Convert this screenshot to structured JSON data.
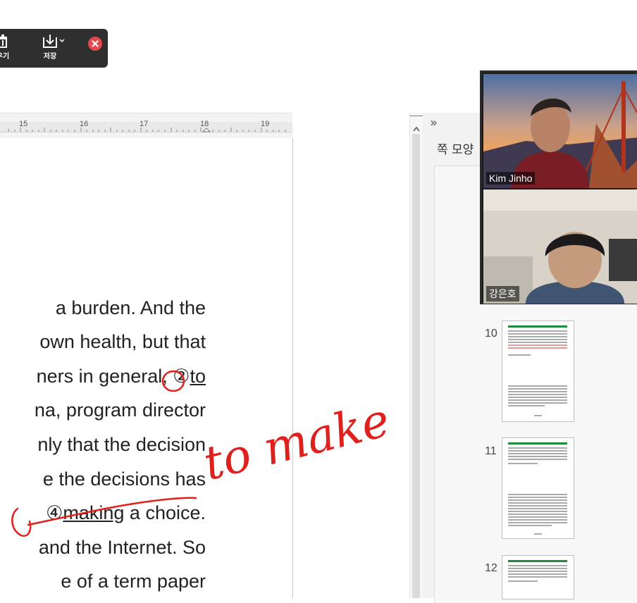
{
  "toolbar": {
    "left_label": "우기",
    "save_label": "저장"
  },
  "ruler": {
    "numbers": [
      "15",
      "16",
      "17",
      "18",
      "19"
    ]
  },
  "document": {
    "lines": [
      {
        "text": "a burden. And the"
      },
      {
        "text": "own health, but that"
      },
      {
        "text": "ners in general, ",
        "circled": "②",
        "underlined": "to"
      },
      {
        "text": "na, program director"
      },
      {
        "text": "nly that the decision"
      },
      {
        "text": "e the decisions has"
      },
      {
        "circled": "④",
        "underlined": "making",
        "rest": " a choice."
      },
      {
        "text": "and the Internet. So"
      },
      {
        "text": "e of a term paper"
      }
    ],
    "handwriting": "to make",
    "annotation_color": "#e0201c"
  },
  "side_panel": {
    "title": "쪽 모양",
    "collapse_glyph": "»",
    "pages": [
      "10",
      "11",
      "12"
    ]
  },
  "video": {
    "participants": [
      {
        "name": "Kim Jinho"
      },
      {
        "name": "강은호"
      }
    ]
  }
}
